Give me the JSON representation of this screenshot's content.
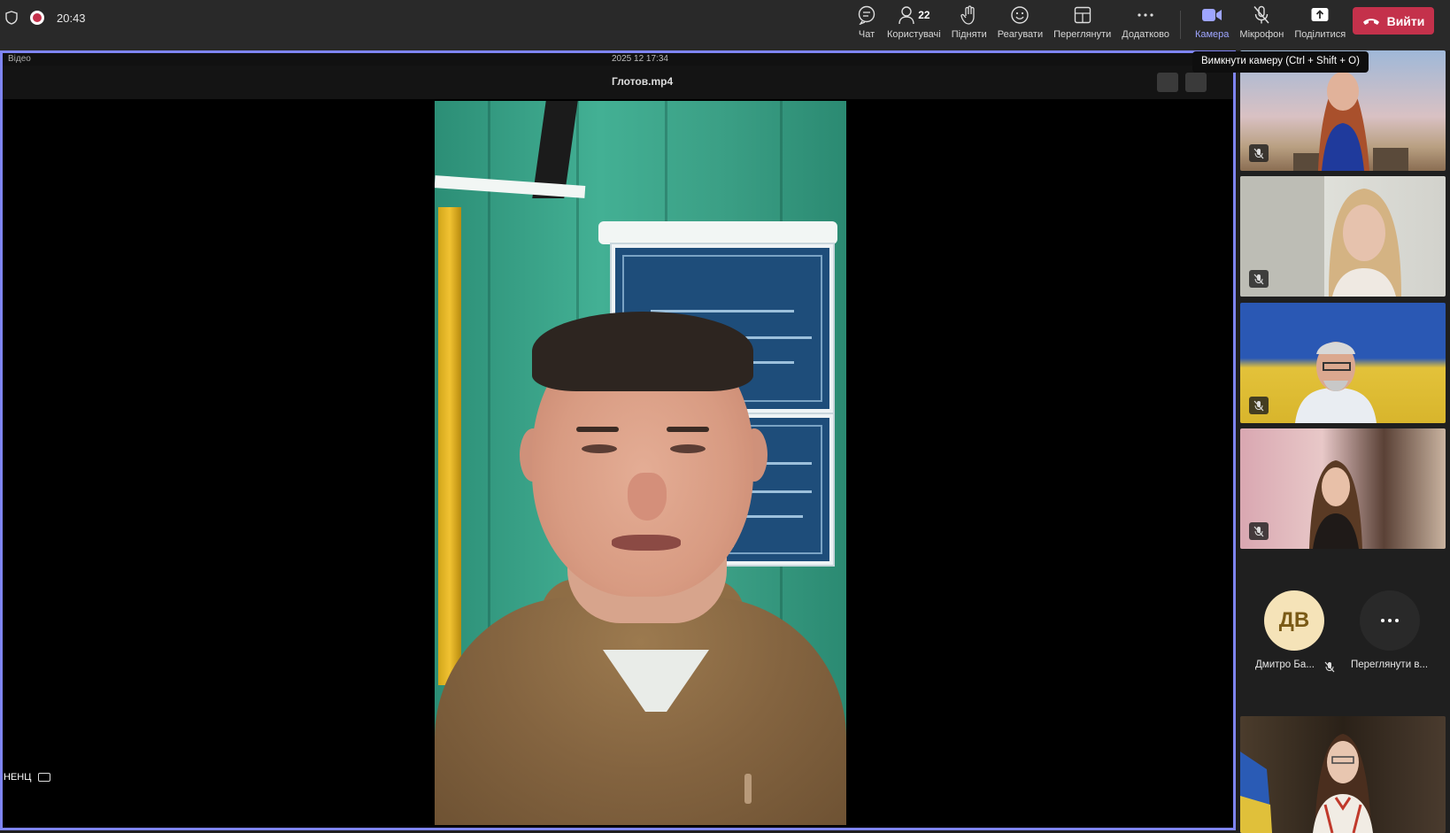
{
  "meeting": {
    "timer": "20:43",
    "leave_label": "Вийти",
    "tooltip": "Вимкнути камеру (Ctrl + Shift + O)"
  },
  "toolbar": [
    {
      "id": "chat",
      "label": "Чат",
      "icon": "chat-icon"
    },
    {
      "id": "people",
      "label": "Користувачі",
      "icon": "people-icon",
      "count": "22"
    },
    {
      "id": "raise",
      "label": "Підняти",
      "icon": "raise-hand-icon"
    },
    {
      "id": "react",
      "label": "Реагувати",
      "icon": "smile-icon"
    },
    {
      "id": "view",
      "label": "Переглянути",
      "icon": "layout-icon"
    },
    {
      "id": "more",
      "label": "Додатково",
      "icon": "more-icon"
    },
    {
      "id": "camera",
      "label": "Камера",
      "icon": "camera-icon",
      "active": true
    },
    {
      "id": "mic",
      "label": "Мікрофон",
      "icon": "mic-off-icon"
    },
    {
      "id": "share",
      "label": "Поділитися",
      "icon": "share-icon"
    }
  ],
  "player": {
    "top_left": "Відео",
    "top_center": "2025 12  17:34",
    "file_name": "Глотов.mp4"
  },
  "status": {
    "language": "НЕНЦ"
  },
  "gallery": {
    "participant_name": "Дмитро Ба...",
    "participant_initials": "ДВ",
    "view_more_label": "Переглянути в...",
    "muted_icon": "mic-off-icon"
  },
  "colors": {
    "accent": "#7f85f5",
    "leave": "#c4314b",
    "active_label": "#9ea5ff"
  }
}
